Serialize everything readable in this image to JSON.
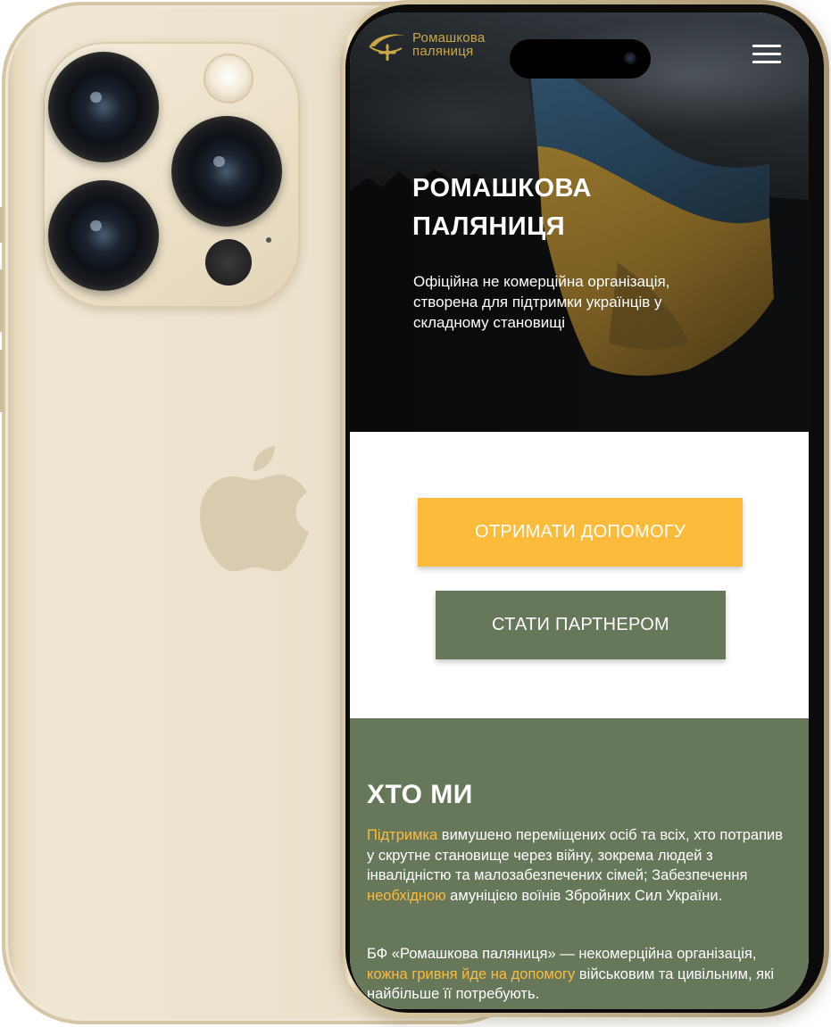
{
  "site": {
    "logo": {
      "line1": "Ромашкова",
      "line2": "паляниця"
    },
    "menu_icon": "hamburger-menu-icon"
  },
  "hero": {
    "title_line1": "РОМАШКОВА",
    "title_line2": "ПАЛЯНИЦЯ",
    "subtitle": "Офіційна не комерційна організація, створена для підтримки українців у складному становищі"
  },
  "actions": {
    "get_help": "ОТРИМАТИ ДОПОМОГУ",
    "become_partner": "СТАТИ ПАРТНЕРОМ"
  },
  "about": {
    "title": "ХТО МИ",
    "p1": {
      "accent1": "Підтримка",
      "text1": " вимушено переміщених осіб та всіх, хто потрапив у скрутне становище через війну, зокрема людей з інвалідністю та малозабезпечених сімей; Забезпечення ",
      "accent2": "необхідною",
      "text2": " амуніцією воїнів Збройних Сил України."
    },
    "p2": {
      "text1": "БФ «Ромашкова паляниця» — некомерційна організація, ",
      "accent1": "кожна гривня йде на допомогу",
      "text2": " військовим та цивільним, які найбільше її потребують."
    }
  },
  "colors": {
    "accent_yellow": "#fdbb3c",
    "olive_green": "#66775a",
    "logo_gold": "#c9a746",
    "phone_gold": "#ece2cd"
  }
}
